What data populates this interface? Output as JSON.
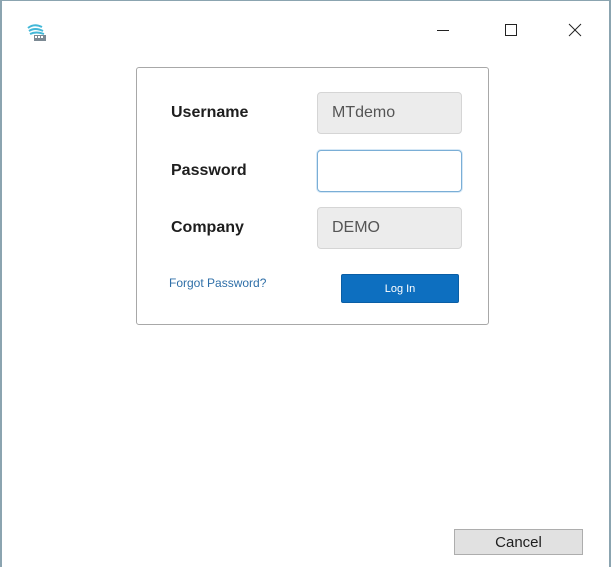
{
  "window": {
    "controls": {
      "minimize_icon": "minimize-icon",
      "maximize_icon": "maximize-icon",
      "close_icon": "close-icon"
    }
  },
  "login": {
    "username_label": "Username",
    "username_value": "MTdemo",
    "password_label": "Password",
    "password_value": "",
    "company_label": "Company",
    "company_value": "DEMO",
    "forgot_password": "Forgot Password?",
    "login_button": "Log In"
  },
  "footer": {
    "cancel_button": "Cancel"
  },
  "colors": {
    "primary_button": "#0d6fc0",
    "link": "#2f6fa8",
    "window_border": "#8ba4b0"
  }
}
